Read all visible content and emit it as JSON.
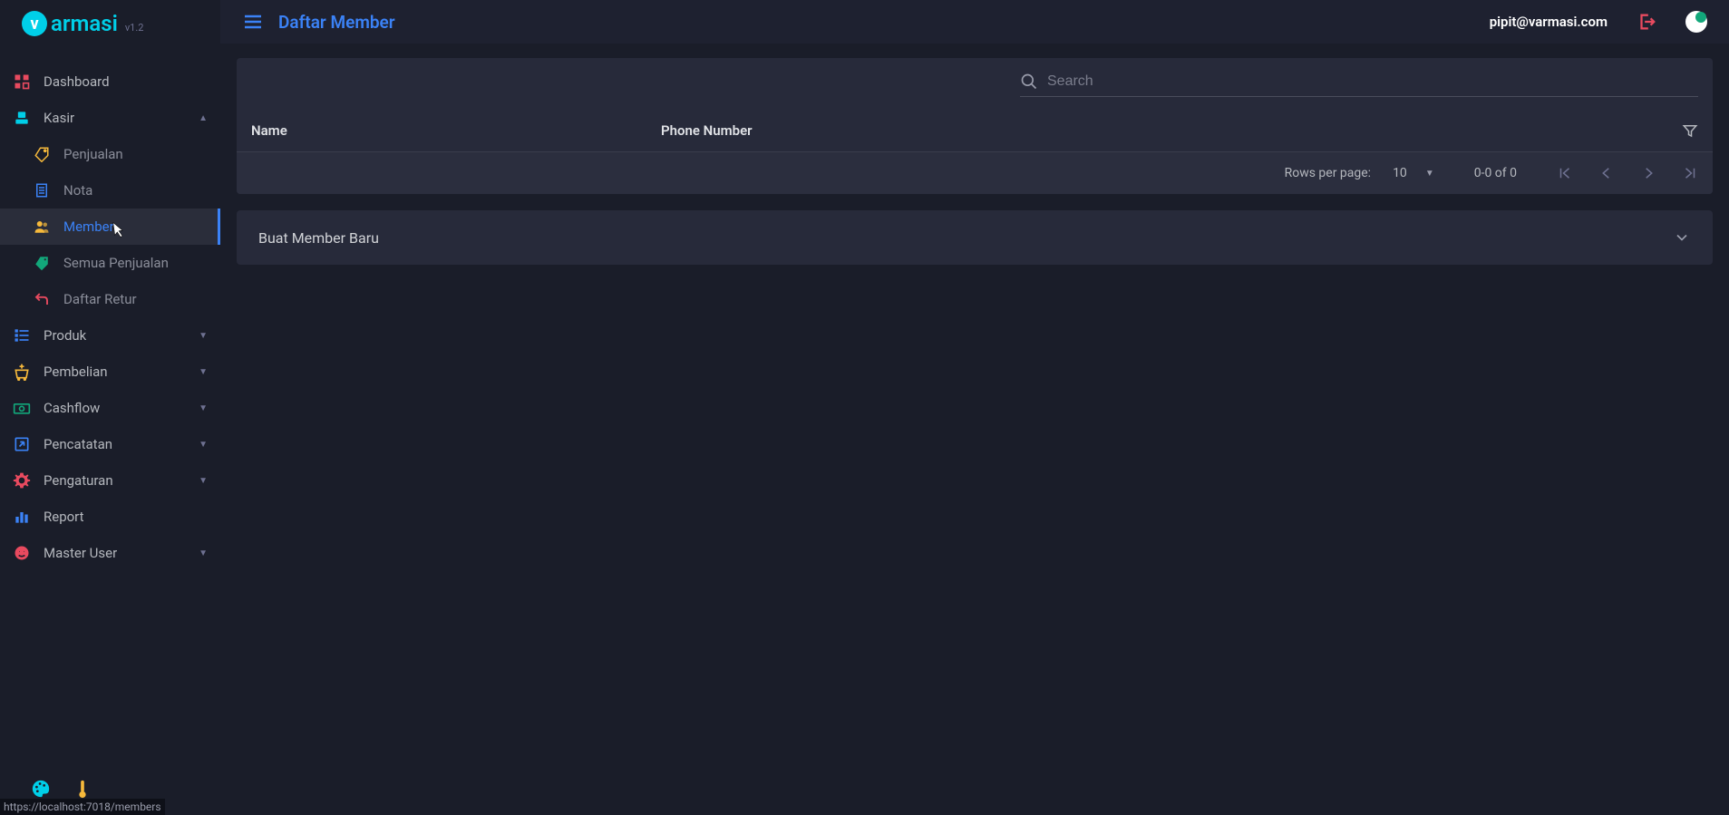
{
  "brand": {
    "name": "armasi",
    "version": "v1.2"
  },
  "header": {
    "title": "Daftar Member",
    "user_email": "pipit@varmasi.com"
  },
  "sidebar": {
    "items": [
      {
        "label": "Dashboard",
        "icon": "dashboard"
      },
      {
        "label": "Kasir",
        "icon": "register",
        "expandable": true,
        "expanded": true,
        "children": [
          {
            "label": "Penjualan",
            "icon": "tag"
          },
          {
            "label": "Nota",
            "icon": "receipt"
          },
          {
            "label": "Member",
            "icon": "members",
            "active": true
          },
          {
            "label": "Semua Penjualan",
            "icon": "tag-fill"
          },
          {
            "label": "Daftar Retur",
            "icon": "return"
          }
        ]
      },
      {
        "label": "Produk",
        "icon": "list",
        "expandable": true
      },
      {
        "label": "Pembelian",
        "icon": "cart-plus",
        "expandable": true
      },
      {
        "label": "Cashflow",
        "icon": "cash",
        "expandable": true
      },
      {
        "label": "Pencatatan",
        "icon": "export",
        "expandable": true
      },
      {
        "label": "Pengaturan",
        "icon": "gear",
        "expandable": true
      },
      {
        "label": "Report",
        "icon": "chart"
      },
      {
        "label": "Master User",
        "icon": "globe",
        "expandable": true
      }
    ]
  },
  "search": {
    "placeholder": "Search"
  },
  "table": {
    "columns": [
      "Name",
      "Phone Number"
    ],
    "footer": {
      "rows_label": "Rows per page:",
      "rows_value": "10",
      "range": "0-0 of 0"
    }
  },
  "create_panel": {
    "title": "Buat Member Baru"
  },
  "status_url": "https://localhost:7018/members",
  "icons": {
    "dashboard_color": "#e84a5f",
    "register_color": "#00cfe8",
    "tag_color": "#f6b93b",
    "receipt_color": "#3b82f6",
    "members_color": "#f6b93b",
    "tagfill_color": "#12a77a",
    "return_color": "#e84a5f",
    "list_color": "#3b82f6",
    "cartplus_color": "#f6b93b",
    "cash_color": "#12a77a",
    "export_color": "#3b82f6",
    "gear_color": "#e84a5f",
    "chart_color": "#3b82f6",
    "globe_color": "#e84a5f",
    "palette_color": "#00cfe8",
    "thermo_color": "#f6b93b"
  }
}
